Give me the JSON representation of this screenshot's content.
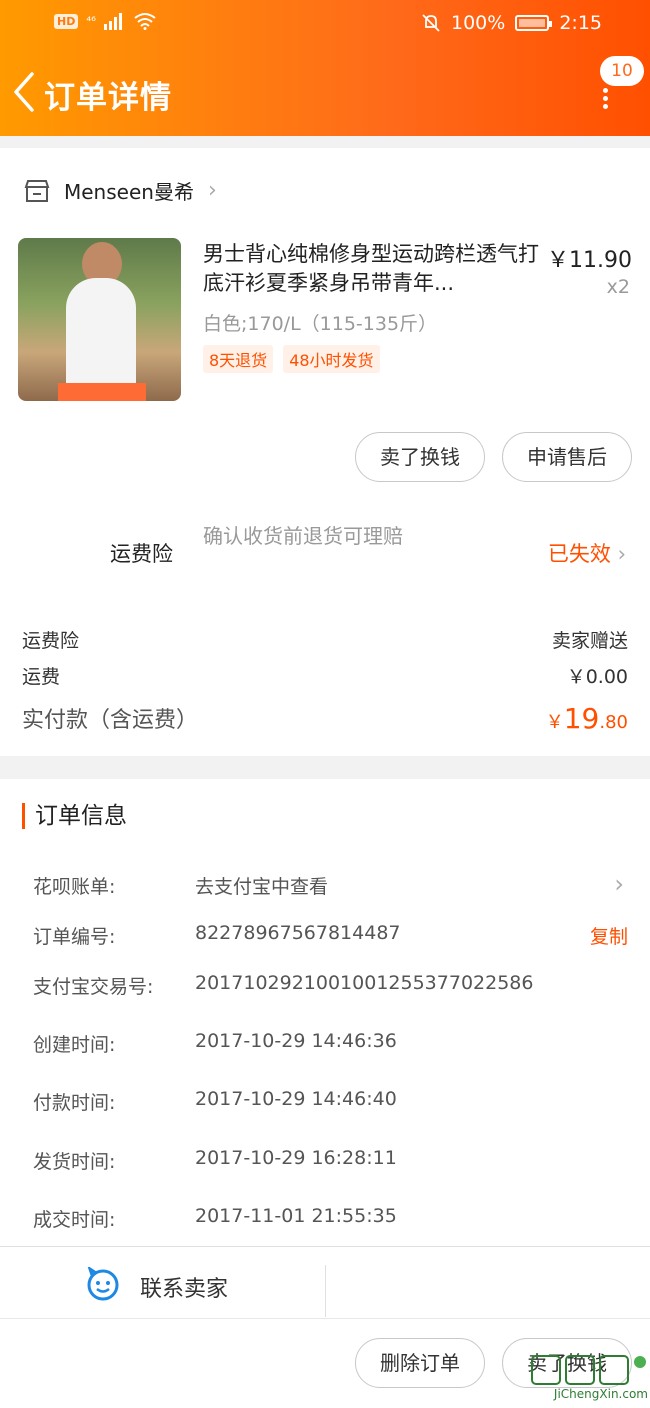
{
  "status_bar": {
    "hd": "HD",
    "network": "⁴⁶",
    "battery_pct": "100%",
    "time": "2:15"
  },
  "header": {
    "title": "订单详情",
    "badge_count": "10"
  },
  "shop": {
    "name": "Menseen曼希"
  },
  "product": {
    "name": "男士背心纯棉修身型运动跨栏透气打底汗衫夏季紧身吊带青年...",
    "price": "￥11.90",
    "qty": "x2",
    "sku": "白色;170/L（115-135斤）",
    "tags": [
      "8天退货",
      "48小时发货"
    ]
  },
  "item_actions": {
    "sell": "卖了换钱",
    "after_sale": "申请售后"
  },
  "insurance": {
    "label": "运费险",
    "desc": "确认收货前退货可理赔",
    "status": "已失效"
  },
  "summary": {
    "ins_label": "运费险",
    "ins_value": "卖家赠送",
    "shipping_label": "运费",
    "shipping_value": "￥0.00",
    "total_label": "实付款（含运费）",
    "total_currency": "￥",
    "total_int": "19",
    "total_dec": ".80"
  },
  "order_info": {
    "title": "订单信息",
    "rows": [
      {
        "key": "花呗账单:",
        "value": "去支付宝中查看"
      },
      {
        "key": "订单编号:",
        "value": "82278967567814487",
        "action": "复制"
      },
      {
        "key": "支付宝交易号:",
        "value": "2017102921001001255377022586"
      },
      {
        "key": "创建时间:",
        "value": "2017-10-29 14:46:36"
      },
      {
        "key": "付款时间:",
        "value": "2017-10-29 14:46:40"
      },
      {
        "key": "发货时间:",
        "value": "2017-10-29 16:28:11"
      },
      {
        "key": "成交时间:",
        "value": "2017-11-01 21:55:35"
      }
    ]
  },
  "contact": {
    "label": "联系卖家"
  },
  "footer": {
    "delete": "删除订单",
    "sell": "卖了换钱"
  },
  "watermark": {
    "text": "JiChengXin.com"
  },
  "colors": {
    "accent": "#ff5000",
    "header_start": "#ff9a00",
    "header_end": "#ff5000"
  }
}
